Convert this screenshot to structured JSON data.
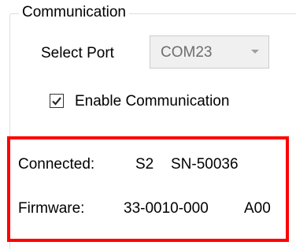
{
  "group": {
    "title": "Communication"
  },
  "port": {
    "label": "Select Port",
    "value": "COM23",
    "dropdown_icon": "chevron-down-icon"
  },
  "communication": {
    "label": "Enable Communication",
    "checked": true
  },
  "status": {
    "connected_label": "Connected:",
    "connected_value": "S2",
    "serial": "SN-50036",
    "firmware_label": "Firmware:",
    "firmware_version": "33-0010-000",
    "firmware_revision": "A00"
  },
  "colors": {
    "highlight": "#ff0000",
    "checkbox_check": "#2a2a2a",
    "disabled_text": "#6d6d6d"
  }
}
